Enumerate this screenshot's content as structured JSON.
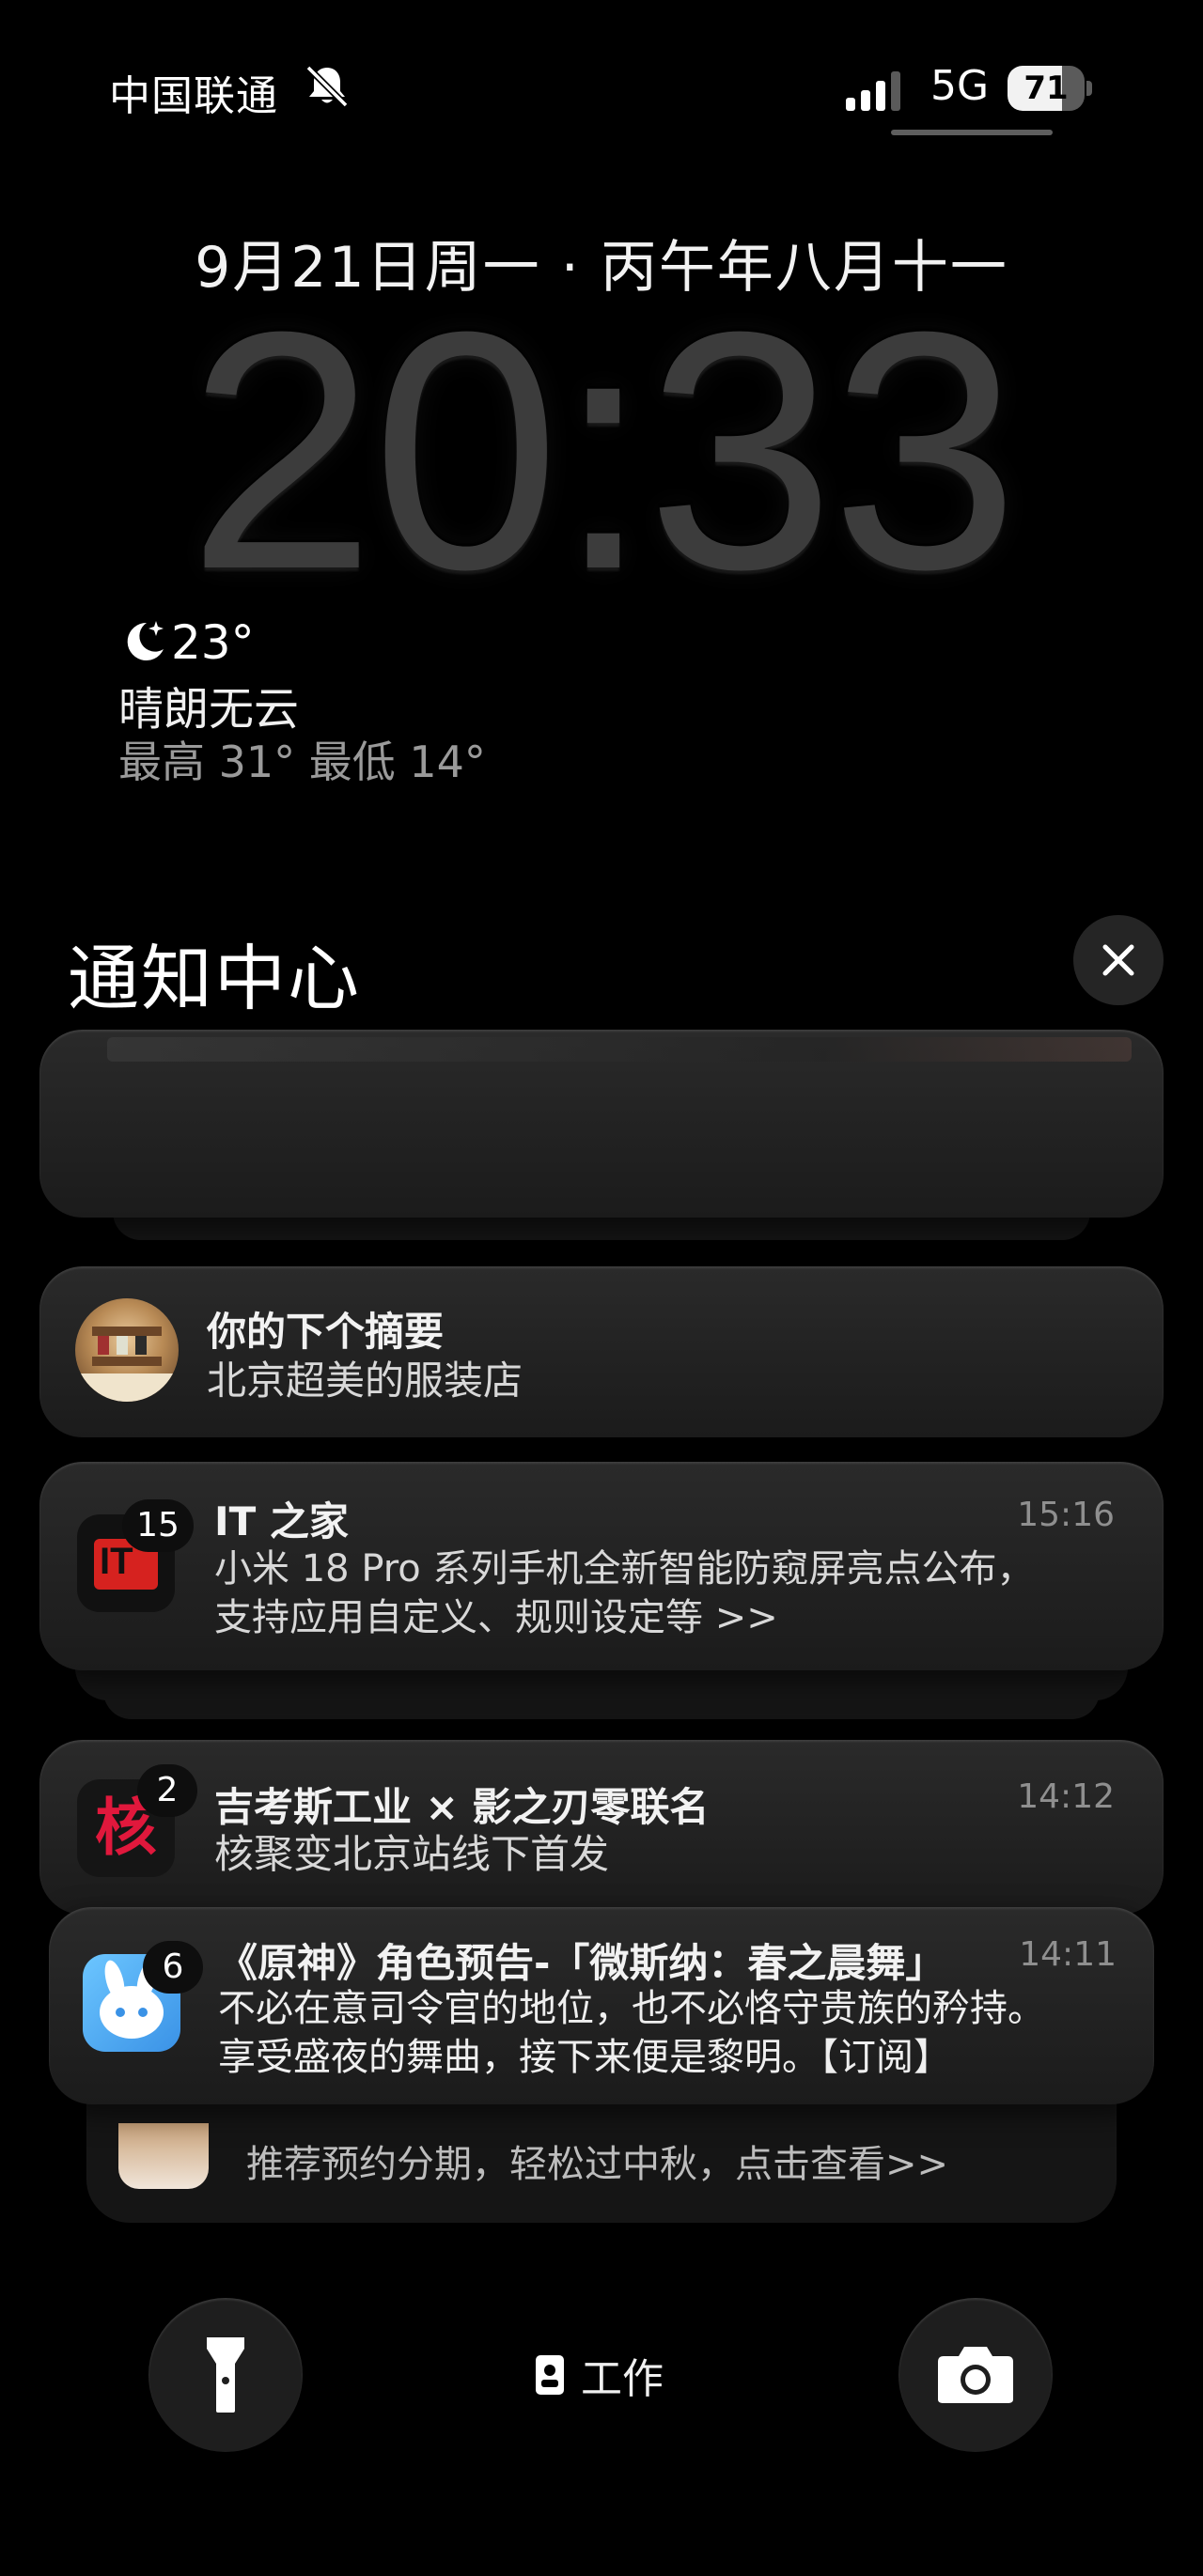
{
  "status_bar": {
    "carrier": "中国联通",
    "network": "5G",
    "battery_percent": "71",
    "battery_level": 0.71
  },
  "lock_screen": {
    "date": "9月21日周一 · 丙午年八月十一",
    "time": "20:33",
    "weather": {
      "temperature": "23°",
      "condition": "晴朗无云",
      "range": "最高 31° 最低 14°",
      "icon": "moon-stars-icon"
    }
  },
  "notification_center": {
    "title": "通知中心",
    "close_icon": "close-icon",
    "summary": {
      "title": "你的下个摘要",
      "subtitle": "北京超美的服装店"
    },
    "notifications": [
      {
        "app": "IT之家",
        "badge": "15",
        "title": "IT 之家",
        "time": "15:16",
        "body_line1": "小米 18 Pro 系列手机全新智能防窥屏亮点公布，",
        "body_line2": "支持应用自定义、规则设定等 >>",
        "icon_text": "IT"
      },
      {
        "app": "核聚变",
        "badge": "2",
        "title": "吉考斯工业 × 影之刃零联名",
        "time": "14:12",
        "body_line1": "核聚变北京站线下首发",
        "icon_text": "核"
      },
      {
        "app": "米游社",
        "badge": "6",
        "title": "《原神》角色预告-「微斯纳：春之晨舞」",
        "time": "14:11",
        "body_line1": "不必在意司令官的地位，也不必恪守贵族的矜持。",
        "body_line2": "享受盛夜的舞曲，接下来便是黎明。【订阅】"
      },
      {
        "app": "unknown",
        "body_line1": "推荐预约分期，轻松过中秋，点击查看>>"
      }
    ]
  },
  "bottom_bar": {
    "left_button": "flashlight-icon",
    "focus_label": "工作",
    "right_button": "camera-icon"
  },
  "colors": {
    "background": "#000000",
    "card": "#222222",
    "badge_bg": "#0e0e0e",
    "it_red": "#d6221f",
    "hejubian_red": "#e0183c",
    "miyoushe_blue": "#4aa8f0"
  }
}
